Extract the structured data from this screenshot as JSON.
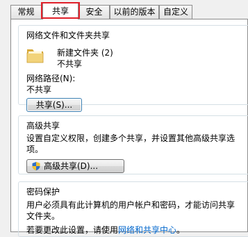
{
  "tabs": [
    {
      "label": "常规"
    },
    {
      "label": "共享"
    },
    {
      "label": "安全"
    },
    {
      "label": "以前的版本"
    },
    {
      "label": "自定义"
    }
  ],
  "active_tab": "共享",
  "network_share": {
    "title": "网络文件和文件夹共享",
    "folder_name": "新建文件夹  (2)",
    "share_status": "不共享",
    "path_label": "网络路径(N):",
    "path_value": "不共享",
    "share_button": "共享(S)..."
  },
  "advanced_share": {
    "title": "高级共享",
    "description_line1": "设置自定义权限，创建多个共享，并设置其他高级共享选",
    "description_line2": "项。",
    "button": "高级共享(D)..."
  },
  "password": {
    "title": "密码保护",
    "line1": "用户必须具有此计算机的用户帐户和密码，才能访问共享",
    "line2": "文件夹。",
    "line3_prefix": "若要更改此设置，请使用",
    "line3_link": "网络和共享中心",
    "line3_suffix": "。"
  },
  "colors": {
    "highlight_border": "#e0202a",
    "link": "#0066cc",
    "folder": "#e8c25a"
  }
}
